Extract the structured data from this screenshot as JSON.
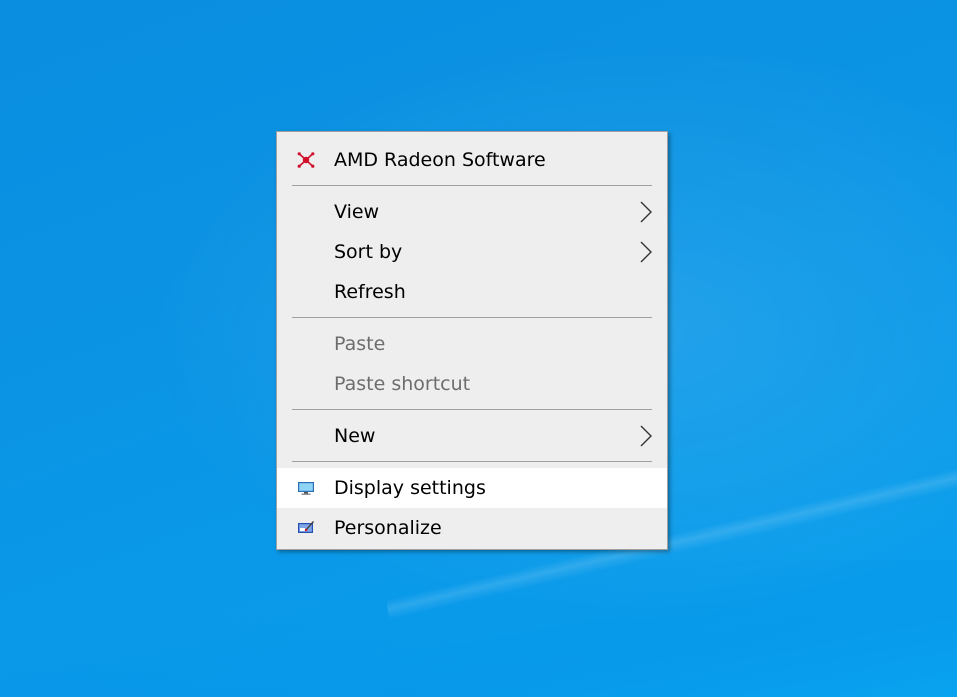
{
  "desktop": {
    "wallpaper_color": "#0b93e3"
  },
  "context_menu": {
    "background": "#eeeeee",
    "highlight_background": "#ffffff",
    "groups": [
      {
        "items": [
          {
            "label": "AMD Radeon Software",
            "icon": "amd-radeon-icon",
            "has_submenu": false,
            "disabled": false
          }
        ]
      },
      {
        "items": [
          {
            "label": "View",
            "icon": null,
            "has_submenu": true,
            "disabled": false
          },
          {
            "label": "Sort by",
            "icon": null,
            "has_submenu": true,
            "disabled": false
          },
          {
            "label": "Refresh",
            "icon": null,
            "has_submenu": false,
            "disabled": false
          }
        ]
      },
      {
        "items": [
          {
            "label": "Paste",
            "icon": null,
            "has_submenu": false,
            "disabled": true
          },
          {
            "label": "Paste shortcut",
            "icon": null,
            "has_submenu": false,
            "disabled": true
          }
        ]
      },
      {
        "items": [
          {
            "label": "New",
            "icon": null,
            "has_submenu": true,
            "disabled": false
          }
        ]
      },
      {
        "items": [
          {
            "label": "Display settings",
            "icon": "display-settings-icon",
            "has_submenu": false,
            "disabled": false,
            "highlighted": true
          },
          {
            "label": "Personalize",
            "icon": "personalize-icon",
            "has_submenu": false,
            "disabled": false
          }
        ]
      }
    ]
  }
}
